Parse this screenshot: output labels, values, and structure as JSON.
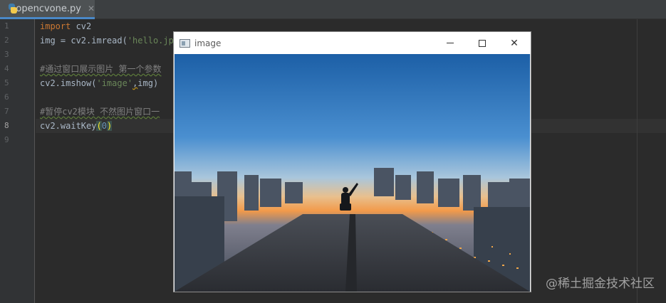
{
  "tab": {
    "filename": "opencvone.py",
    "close": "✕"
  },
  "editor": {
    "line_numbers": [
      "1",
      "2",
      "3",
      "4",
      "5",
      "6",
      "7",
      "8",
      "9"
    ],
    "active_line": "8",
    "lines": {
      "l1_kw": "import",
      "l1_rest": " cv2",
      "l2_a": "img = cv2.imread(",
      "l2_str": "'hello.jpg",
      "l4_cmt": "#通过窗口展示图片 第一个参数",
      "l5_a": "cv2.imshow(",
      "l5_str": "'image'",
      "l5_comma": ",",
      "l5_b": "img)",
      "l7_cmt": "#暂停cv2模块 不然图片窗口一",
      "l8_a": "cv2.waitKey",
      "l8_open": "(",
      "l8_num": "0",
      "l8_close": ")"
    }
  },
  "image_window": {
    "title": "image",
    "min_icon": "minimize-icon",
    "max_icon": "maximize-icon",
    "close_glyph": "✕"
  },
  "watermark": "@稀土掘金技术社区",
  "colors": {
    "editor_bg": "#2b2b2b",
    "keyword": "#cc7832",
    "string": "#6a8759",
    "comment": "#808080",
    "number": "#6897bb"
  }
}
